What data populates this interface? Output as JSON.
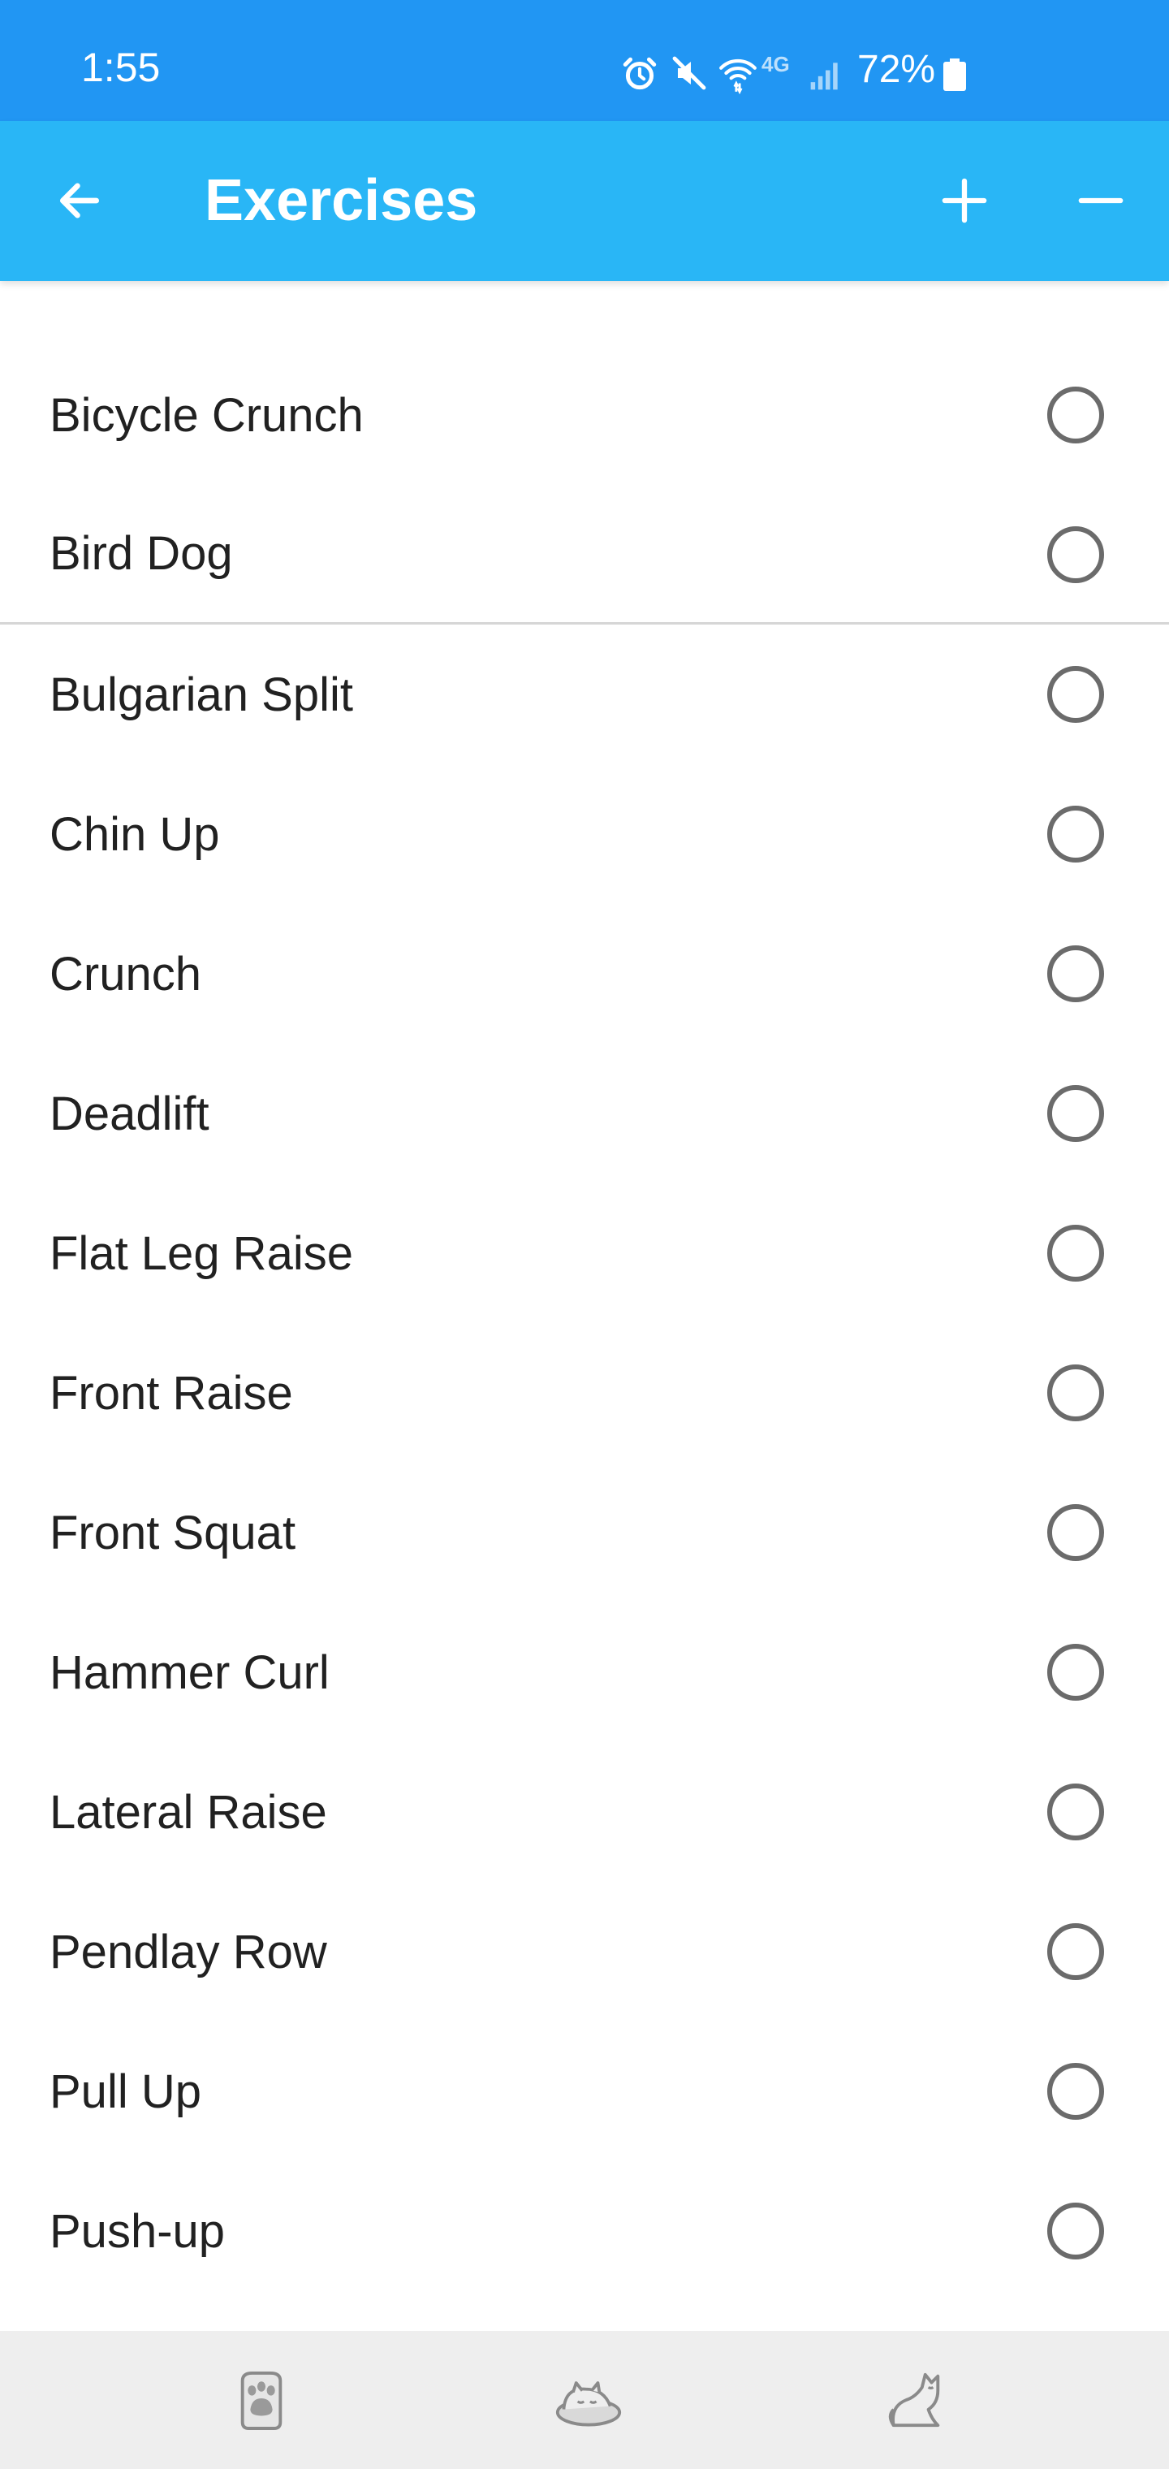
{
  "status_bar": {
    "time": "1:55",
    "network": "4G",
    "battery": "72%",
    "icons": [
      "alarm-icon",
      "mute-icon",
      "wifi-icon",
      "signal-icon",
      "battery-icon"
    ]
  },
  "app_bar": {
    "title": "Exercises",
    "back_icon": "arrow-left-icon",
    "add_icon": "plus-icon",
    "remove_icon": "minus-icon"
  },
  "exercises": [
    {
      "label": "Bicycle Crunch",
      "selected": false
    },
    {
      "label": "Bird Dog",
      "selected": false
    },
    {
      "label": "Bulgarian Split",
      "selected": false
    },
    {
      "label": "Chin Up",
      "selected": false
    },
    {
      "label": "Crunch",
      "selected": false
    },
    {
      "label": "Deadlift",
      "selected": false
    },
    {
      "label": "Flat Leg Raise",
      "selected": false
    },
    {
      "label": "Front Raise",
      "selected": false
    },
    {
      "label": "Front Squat",
      "selected": false
    },
    {
      "label": "Hammer Curl",
      "selected": false
    },
    {
      "label": "Lateral Raise",
      "selected": false
    },
    {
      "label": "Pendlay Row",
      "selected": false
    },
    {
      "label": "Pull Up",
      "selected": false
    },
    {
      "label": "Push-up",
      "selected": false
    }
  ],
  "bottom_nav": {
    "items": [
      "paw-icon",
      "sleeping-cat-icon",
      "stretching-cat-icon"
    ]
  },
  "colors": {
    "status_bar": "#2196f3",
    "app_bar": "#29b6f6",
    "radio_border": "#6b6b6b",
    "bottom_nav": "#eeeeee"
  }
}
